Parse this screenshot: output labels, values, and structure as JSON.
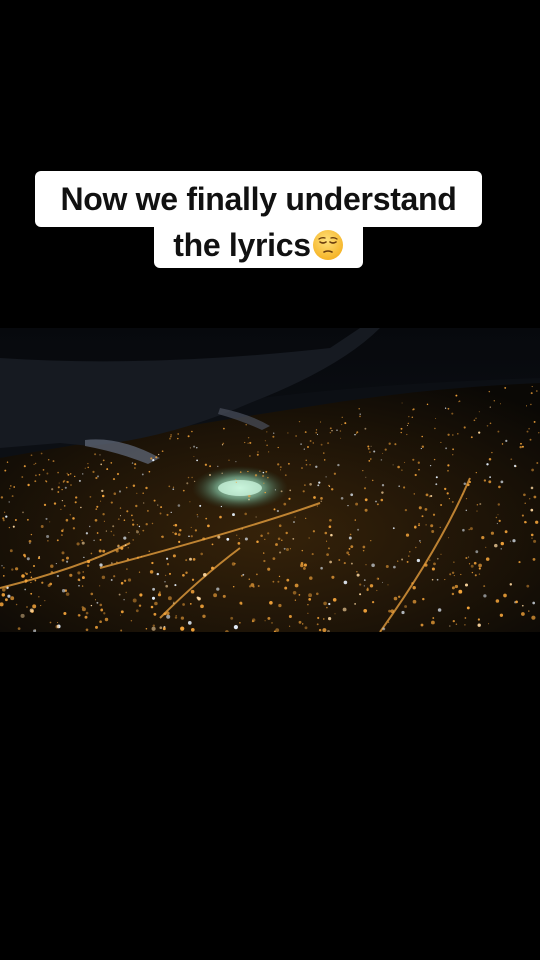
{
  "caption": {
    "line1": "Now we finally understand",
    "line2": "the lyrics",
    "emoji": "pensive-face-emoji"
  },
  "video": {
    "scene": "night-city-aerial-from-airplane-window"
  },
  "colors": {
    "background": "#000000",
    "caption_bg": "#ffffff",
    "caption_text": "#111111",
    "city_light": "#f2a33a",
    "sky": "#0b0d12"
  }
}
